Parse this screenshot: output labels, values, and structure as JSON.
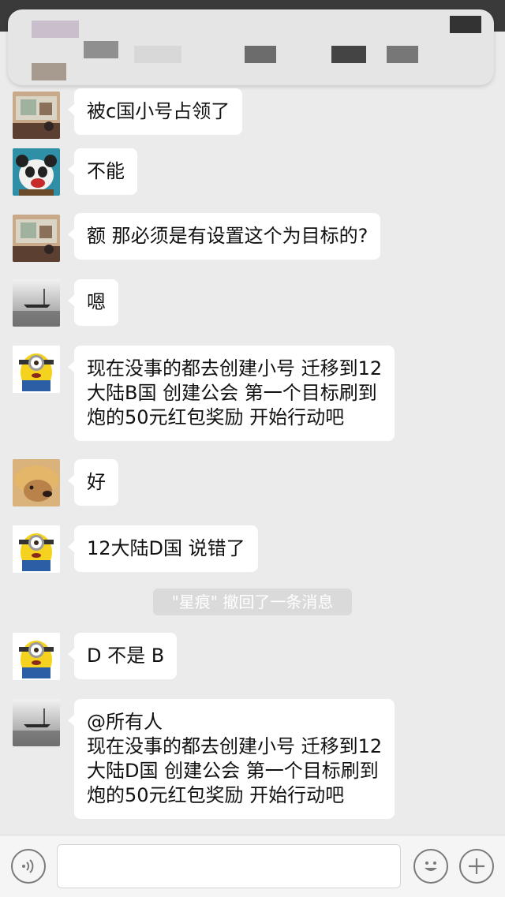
{
  "messages": [
    {
      "avatar": "painting-avatar",
      "lines": [
        "被c国小号占领了"
      ]
    },
    {
      "avatar": "panda-avatar",
      "lines": [
        "不能"
      ]
    },
    {
      "avatar": "painting-avatar",
      "lines": [
        "额 那必须是有设置这个为目标的?"
      ]
    },
    {
      "avatar": "boat-avatar",
      "lines": [
        "嗯"
      ]
    },
    {
      "avatar": "minion-avatar",
      "lines": [
        "现在没事的都去创建小号 迁移到12",
        "大陆B国 创建公会 第一个目标刷到",
        "炮的50元红包奖励 开始行动吧"
      ]
    },
    {
      "avatar": "dog-avatar",
      "lines": [
        "好"
      ]
    },
    {
      "avatar": "minion-avatar",
      "lines": [
        "12大陆D国 说错了"
      ]
    },
    {
      "avatar": "minion-avatar",
      "lines": [
        "D 不是 B"
      ]
    },
    {
      "avatar": "boat-avatar",
      "lines": [
        "@所有人",
        "现在没事的都去创建小号 迁移到12",
        "大陆D国 创建公会 第一个目标刷到",
        "炮的50元红包奖励 开始行动吧"
      ]
    }
  ],
  "system_notice": "\"星痕\" 撤回了一条消息",
  "input_bar": {
    "voice_icon": "voice-icon",
    "emoji_icon": "emoji-icon",
    "plus_icon": "plus-icon"
  },
  "colors": {
    "background": "#ebebeb",
    "bubble": "#ffffff",
    "system_notice_bg": "#dadada"
  }
}
